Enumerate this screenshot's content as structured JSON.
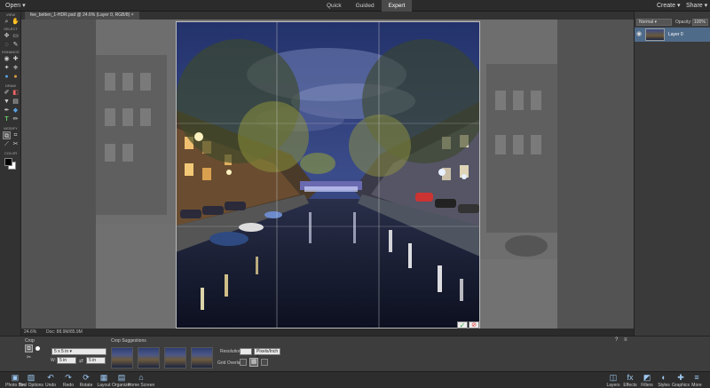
{
  "topbar": {
    "open_label": "Open",
    "modes": [
      {
        "label": "Quick",
        "active": false
      },
      {
        "label": "Guided",
        "active": false
      },
      {
        "label": "Expert",
        "active": true
      }
    ],
    "create_label": "Create",
    "share_label": "Share"
  },
  "document": {
    "tab_title": "fee_betten_1-HDR.psd @ 24.6% (Layer 0, RGB/8)"
  },
  "toolbox": {
    "sections": [
      "VIEW",
      "SELECT",
      "ENHANCE",
      "DRAW",
      "MODIFY",
      "COLOR"
    ],
    "tools": [
      {
        "icon": "zoom-tool-icon",
        "glyph": "⌕"
      },
      {
        "icon": "hand-tool-icon",
        "glyph": "✋"
      },
      {
        "icon": "move-tool-icon",
        "glyph": "✥"
      },
      {
        "icon": "marquee-tool-icon",
        "glyph": "▭"
      },
      {
        "icon": "lasso-tool-icon",
        "glyph": "◌"
      },
      {
        "icon": "quick-selection-icon",
        "glyph": "✎"
      },
      {
        "icon": "eye-tool-icon",
        "glyph": "◉"
      },
      {
        "icon": "spot-healing-icon",
        "glyph": "✚"
      },
      {
        "icon": "smart-brush-icon",
        "glyph": "✦"
      },
      {
        "icon": "clone-stamp-icon",
        "glyph": "⎈"
      },
      {
        "icon": "blur-tool-icon",
        "glyph": "💧"
      },
      {
        "icon": "sponge-tool-icon",
        "glyph": "●"
      },
      {
        "icon": "brush-tool-icon",
        "glyph": "✐"
      },
      {
        "icon": "eraser-tool-icon",
        "glyph": "◧"
      },
      {
        "icon": "paint-bucket-icon",
        "glyph": "▼"
      },
      {
        "icon": "gradient-tool-icon",
        "glyph": "▤"
      },
      {
        "icon": "color-picker-icon",
        "glyph": "✒"
      },
      {
        "icon": "shape-tool-icon",
        "glyph": "◆"
      },
      {
        "icon": "type-tool-icon",
        "glyph": "T"
      },
      {
        "icon": "pencil-tool-icon",
        "glyph": "✏"
      },
      {
        "icon": "crop-tool-icon",
        "glyph": "⧉"
      },
      {
        "icon": "recompose-tool-icon",
        "glyph": "⌗"
      },
      {
        "icon": "straighten-tool-icon",
        "glyph": "⟋"
      },
      {
        "icon": "cookie-cutter-icon",
        "glyph": "✂"
      }
    ],
    "foreground_color": "#000000",
    "background_color": "#ffffff"
  },
  "status": {
    "zoom": "24.6%",
    "doc_info": "Doc: 88.9M/85.9M"
  },
  "layers_panel": {
    "blend_mode": "Normal",
    "opacity_label": "Opacity:",
    "opacity_value": "100%",
    "layers": [
      {
        "name": "Layer 0",
        "visible": true,
        "selected": true
      }
    ]
  },
  "tool_options": {
    "tool_label": "Crop",
    "aspect_preset": "5 x 5 in",
    "width_label": "W:",
    "width_value": "5 in",
    "height_value": "5 in",
    "suggestions_label": "Crop Suggestions",
    "resolution_label": "Resolution:",
    "resolution_value": "",
    "resolution_unit": "Pixels/Inch",
    "grid_overlay_label": "Grid Overlay:"
  },
  "bottom_bar": {
    "left": [
      {
        "label": "Photo Bin",
        "icon": "photo-bin-icon",
        "glyph": "▣"
      },
      {
        "label": "Tool Options",
        "icon": "tool-options-icon",
        "glyph": "▨"
      },
      {
        "label": "Undo",
        "icon": "undo-icon",
        "glyph": "↶"
      },
      {
        "label": "Redo",
        "icon": "redo-icon",
        "glyph": "↷"
      },
      {
        "label": "Rotate",
        "icon": "rotate-icon",
        "glyph": "⟳"
      },
      {
        "label": "Layout",
        "icon": "layout-icon",
        "glyph": "▦"
      },
      {
        "label": "Organizer",
        "icon": "organizer-icon",
        "glyph": "▤"
      },
      {
        "label": "Home Screen",
        "icon": "home-screen-icon",
        "glyph": "⌂"
      }
    ],
    "right": [
      {
        "label": "Layers",
        "icon": "layers-icon",
        "glyph": "◫"
      },
      {
        "label": "Effects",
        "icon": "effects-icon",
        "glyph": "fx"
      },
      {
        "label": "Filters",
        "icon": "filters-icon",
        "glyph": "◩"
      },
      {
        "label": "Styles",
        "icon": "styles-icon",
        "glyph": "◐"
      },
      {
        "label": "Graphics",
        "icon": "graphics-icon",
        "glyph": "✚"
      },
      {
        "label": "More",
        "icon": "more-icon",
        "glyph": "≡"
      }
    ]
  },
  "colors": {
    "accent": "#4a90d9",
    "commit_green": "#3cb043",
    "cancel_red": "#e02a2a"
  }
}
